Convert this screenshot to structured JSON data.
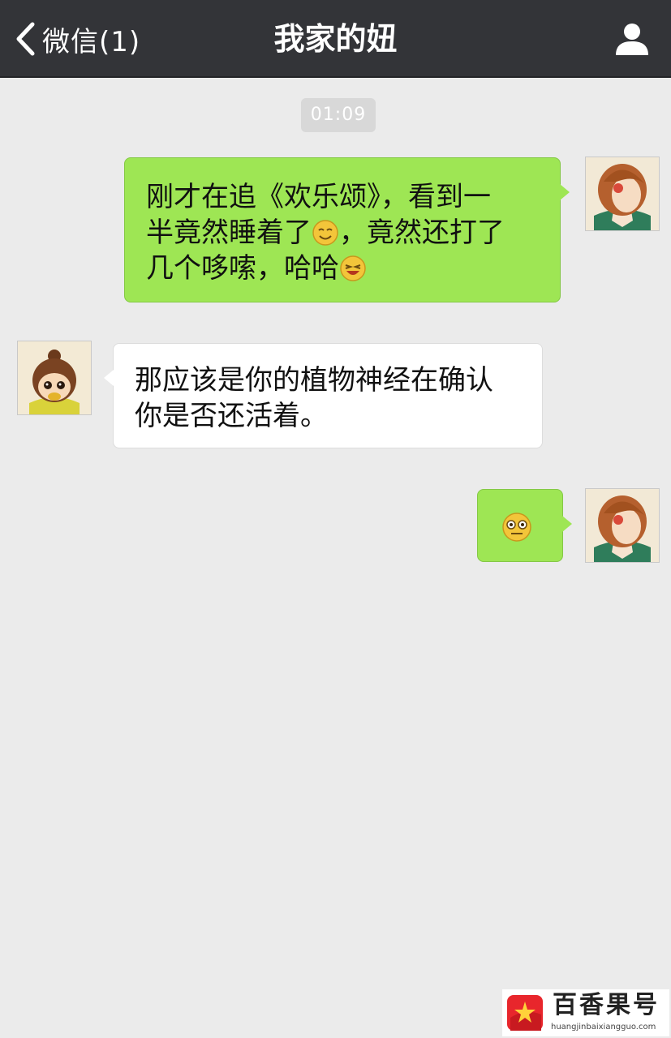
{
  "header": {
    "back_label": "微信(1)",
    "title": "我家的妞",
    "profile_icon": "person-icon",
    "background_color": "#333438"
  },
  "chat": {
    "timestamp": "01:09",
    "messages": [
      {
        "sender": "self",
        "lines": [
          "刚才在追《欢乐颂》，看到一",
          "半竟然睡着了",
          "，竟然还打了",
          "几个哆嗦，哈哈"
        ],
        "emojis": [
          "smile-emoji",
          "laugh-emoji"
        ]
      },
      {
        "sender": "other",
        "text": "那应该是你的植物神经在确认\n你是否还活着。"
      },
      {
        "sender": "self",
        "emojis": [
          "awkward-emoji"
        ]
      }
    ],
    "bubble_colors": {
      "self": "#9ee654",
      "other": "#ffffff"
    }
  },
  "watermark": {
    "brand": "百香果号",
    "url": "huangjinbaixiangguo.com"
  }
}
